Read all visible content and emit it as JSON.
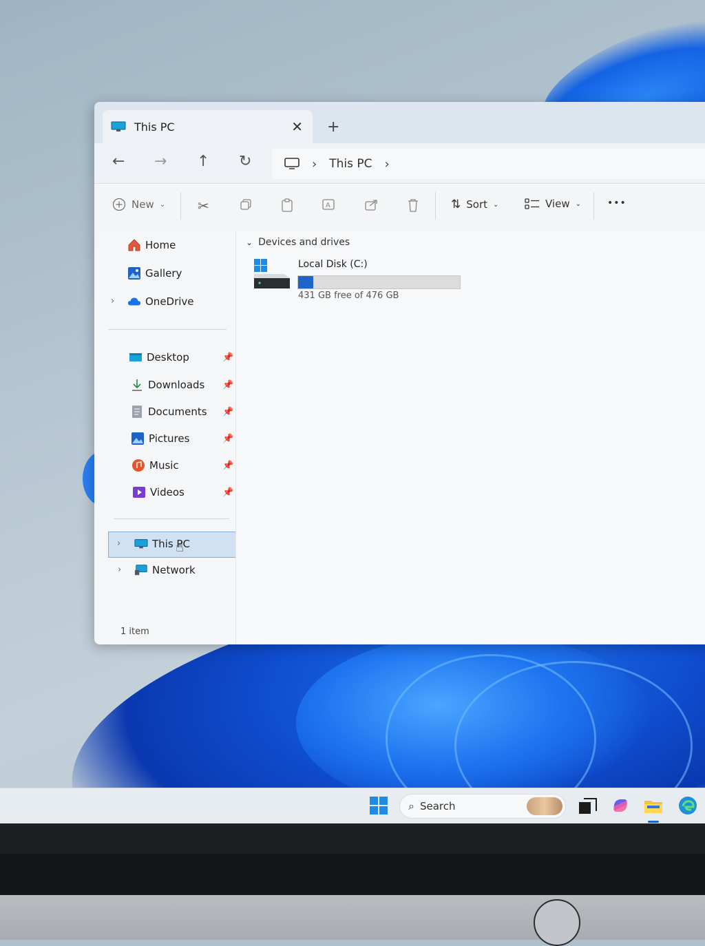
{
  "window": {
    "tab_title": "This PC",
    "new_tab": "+",
    "close": "✕"
  },
  "address": {
    "location": "This PC"
  },
  "commands": {
    "new": "New",
    "sort": "Sort",
    "view": "View",
    "more": "•••"
  },
  "sidebar": {
    "home": "Home",
    "gallery": "Gallery",
    "onedrive": "OneDrive",
    "quick": [
      {
        "label": "Desktop"
      },
      {
        "label": "Downloads"
      },
      {
        "label": "Documents"
      },
      {
        "label": "Pictures"
      },
      {
        "label": "Music"
      },
      {
        "label": "Videos"
      }
    ],
    "this_pc": "This PC",
    "network": "Network"
  },
  "content": {
    "group": "Devices and drives",
    "drive": {
      "name": "Local Disk (C:)",
      "free_text": "431 GB free of 476 GB",
      "used_fraction": 0.095
    }
  },
  "status": {
    "items": "1 item"
  },
  "taskbar": {
    "search_placeholder": "Search"
  },
  "colors": {
    "accent": "#1f64c8",
    "selection": "#cfe1f2"
  }
}
